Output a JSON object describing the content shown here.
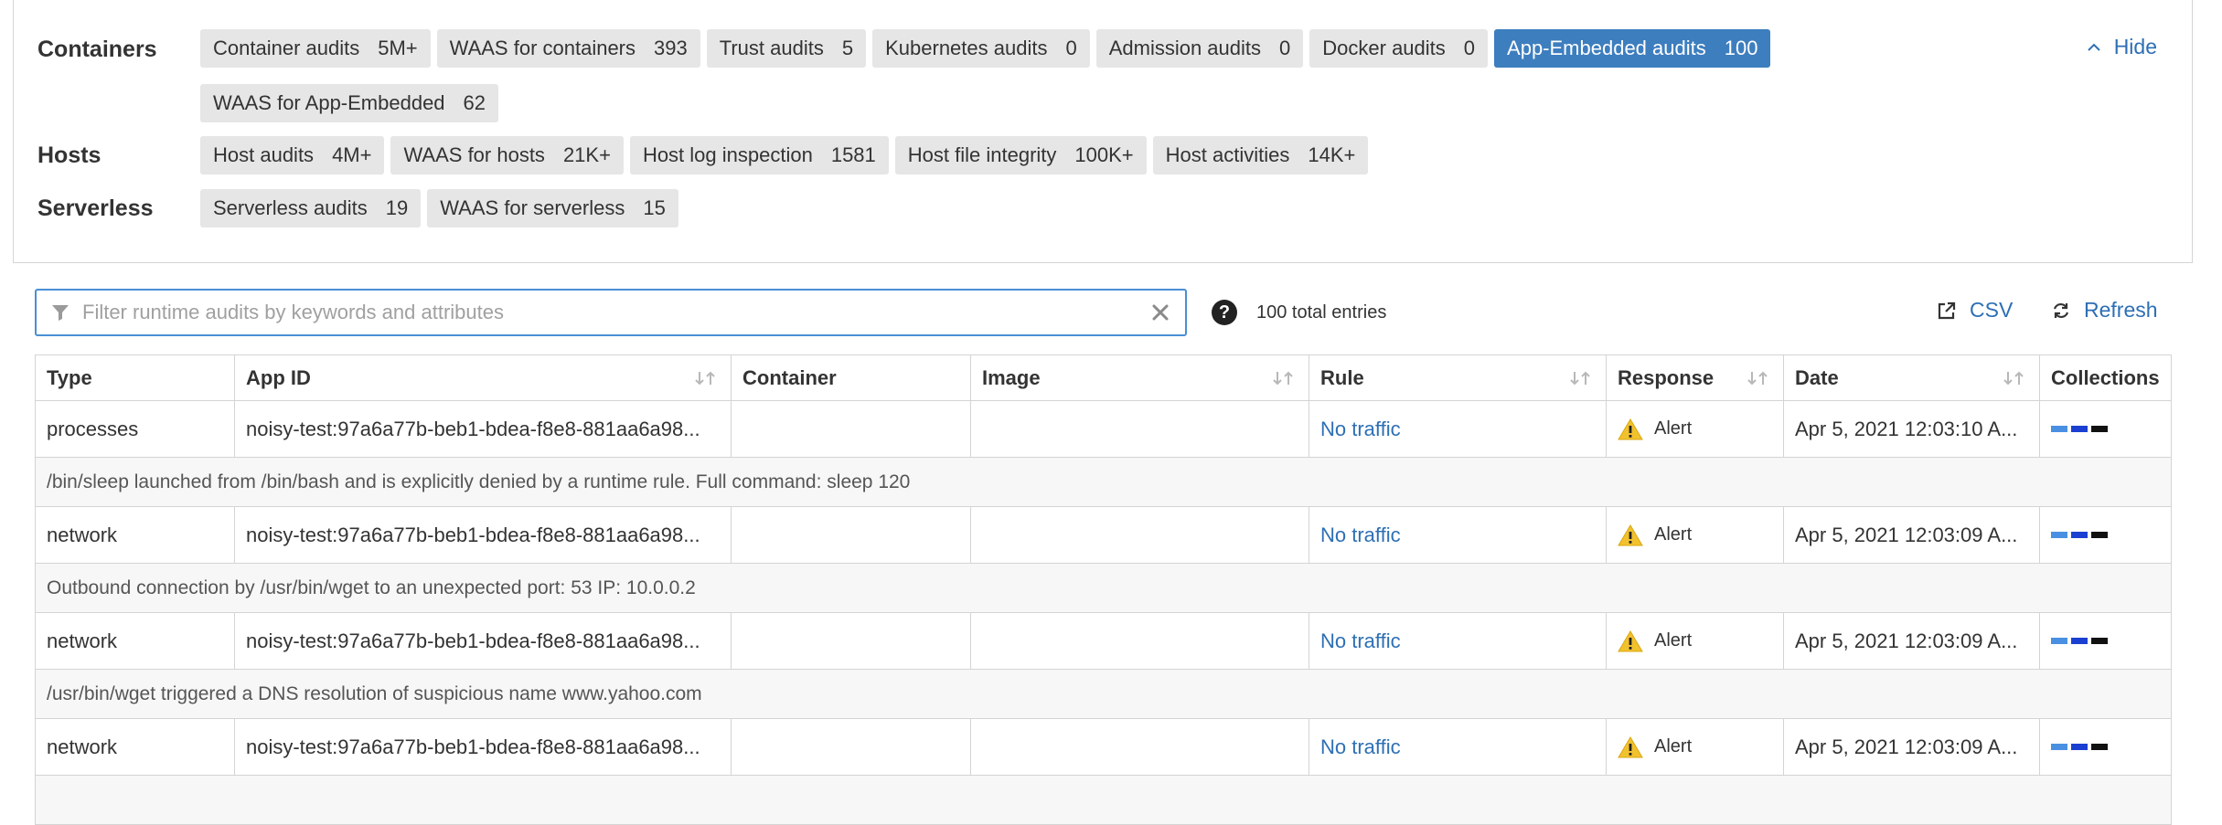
{
  "categories": [
    {
      "label": "Containers",
      "rows": [
        [
          {
            "label": "Container audits",
            "count": "5M+",
            "active": false
          },
          {
            "label": "WAAS for containers",
            "count": "393",
            "active": false
          },
          {
            "label": "Trust audits",
            "count": "5",
            "active": false
          },
          {
            "label": "Kubernetes audits",
            "count": "0",
            "active": false
          },
          {
            "label": "Admission audits",
            "count": "0",
            "active": false
          },
          {
            "label": "Docker audits",
            "count": "0",
            "active": false
          },
          {
            "label": "App-Embedded audits",
            "count": "100",
            "active": true
          }
        ],
        [
          {
            "label": "WAAS for App-Embedded",
            "count": "62",
            "active": false
          }
        ]
      ]
    },
    {
      "label": "Hosts",
      "rows": [
        [
          {
            "label": "Host audits",
            "count": "4M+",
            "active": false
          },
          {
            "label": "WAAS for hosts",
            "count": "21K+",
            "active": false
          },
          {
            "label": "Host log inspection",
            "count": "1581",
            "active": false
          },
          {
            "label": "Host file integrity",
            "count": "100K+",
            "active": false
          },
          {
            "label": "Host activities",
            "count": "14K+",
            "active": false
          }
        ]
      ]
    },
    {
      "label": "Serverless",
      "rows": [
        [
          {
            "label": "Serverless audits",
            "count": "19",
            "active": false
          },
          {
            "label": "WAAS for serverless",
            "count": "15",
            "active": false
          }
        ]
      ]
    }
  ],
  "hide_label": "Hide",
  "filter": {
    "placeholder": "Filter runtime audits by keywords and attributes",
    "value": ""
  },
  "total_entries": "100 total entries",
  "actions": {
    "csv": "CSV",
    "refresh": "Refresh"
  },
  "table": {
    "headers": [
      "Type",
      "App ID",
      "Container",
      "Image",
      "Rule",
      "Response",
      "Date",
      "Collections"
    ],
    "rows": [
      {
        "type": "processes",
        "app_id": "noisy-test:97a6a77b-beb1-bdea-f8e8-881aa6a98...",
        "container": "",
        "image": "",
        "rule": "No traffic",
        "response": "Alert",
        "date": "Apr 5, 2021 12:03:10 A...",
        "description": "/bin/sleep launched from /bin/bash and is explicitly denied by a runtime rule. Full command: sleep 120"
      },
      {
        "type": "network",
        "app_id": "noisy-test:97a6a77b-beb1-bdea-f8e8-881aa6a98...",
        "container": "",
        "image": "",
        "rule": "No traffic",
        "response": "Alert",
        "date": "Apr 5, 2021 12:03:09 A...",
        "description": "Outbound connection by /usr/bin/wget to an unexpected port: 53 IP: 10.0.0.2"
      },
      {
        "type": "network",
        "app_id": "noisy-test:97a6a77b-beb1-bdea-f8e8-881aa6a98...",
        "container": "",
        "image": "",
        "rule": "No traffic",
        "response": "Alert",
        "date": "Apr 5, 2021 12:03:09 A...",
        "description": "/usr/bin/wget triggered a DNS resolution of suspicious name www.yahoo.com"
      },
      {
        "type": "network",
        "app_id": "noisy-test:97a6a77b-beb1-bdea-f8e8-881aa6a98...",
        "container": "",
        "image": "",
        "rule": "No traffic",
        "response": "Alert",
        "date": "Apr 5, 2021 12:03:09 A...",
        "description": ""
      }
    ]
  },
  "colors": {
    "accent": "#2d6fb5",
    "active_chip": "#3d7ebf",
    "chip_bg": "#e6e6e6",
    "alert_yellow": "#f2c12e",
    "collection_swatches": [
      "#4a90e2",
      "#1a3fd1",
      "#111111"
    ]
  },
  "icons": {
    "filter": "funnel-icon",
    "clear": "close-icon",
    "help": "question-circle-icon",
    "csv": "external-link-icon",
    "refresh": "refresh-icon",
    "hide": "chevron-up-icon",
    "sort": "sort-arrows-icon",
    "alert": "warning-triangle-icon"
  }
}
